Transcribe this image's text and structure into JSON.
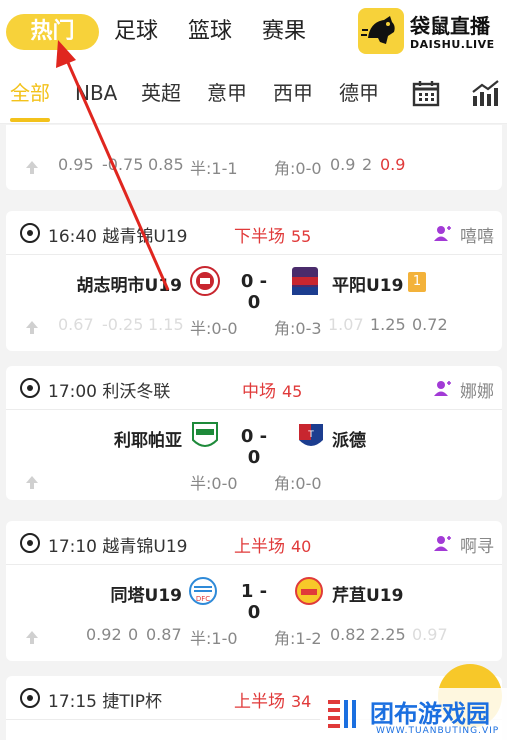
{
  "top_tabs": [
    "热门",
    "足球",
    "篮球",
    "赛果"
  ],
  "logo": {
    "cn": "袋鼠直播",
    "en": "DAISHU.LIVE"
  },
  "sub_tabs": [
    "全部",
    "NBA",
    "英超",
    "意甲",
    "西甲",
    "德甲"
  ],
  "colors": {
    "accent": "#f3c21b",
    "live_red": "#e03a3a",
    "host_purple": "#a23ad6"
  },
  "partial_card": {
    "odds": [
      "0.95",
      "-0.75",
      "0.85",
      "半:1-1",
      "角:0-0",
      "0.9",
      "2",
      "0.9"
    ]
  },
  "matches": [
    {
      "time_league": "16:40 越青锦U19",
      "status": "下半场",
      "minute": "55",
      "host": "嘻嘻",
      "home": "胡志明市U19",
      "score": "0 - 0",
      "away": "平阳U19",
      "away_badge": "1",
      "odds": [
        "0.67",
        "-0.25",
        "1.15",
        "半:0-0",
        "角:0-3",
        "1.07",
        "1.25",
        "0.72"
      ]
    },
    {
      "time_league": "17:00 利沃冬联",
      "status": "中场",
      "minute": "45",
      "host": "娜娜",
      "home": "利耶帕亚",
      "score": "0 - 0",
      "away": "派德",
      "odds": [
        "半:0-0",
        "角:0-0"
      ]
    },
    {
      "time_league": "17:10 越青锦U19",
      "status": "上半场",
      "minute": "40",
      "host": "啊寻",
      "home": "同塔U19",
      "score": "1 - 0",
      "away": "芹苴U19",
      "odds": [
        "0.92",
        "0",
        "0.87",
        "半:1-0",
        "角:1-2",
        "0.82",
        "2.25",
        "0.97"
      ]
    },
    {
      "time_league": "17:15 捷TIP杯",
      "status": "上半场",
      "minute": "34"
    }
  ],
  "watermark": {
    "cn": "团布游戏园",
    "en": "WWW.TUANBUTING.VIP"
  }
}
